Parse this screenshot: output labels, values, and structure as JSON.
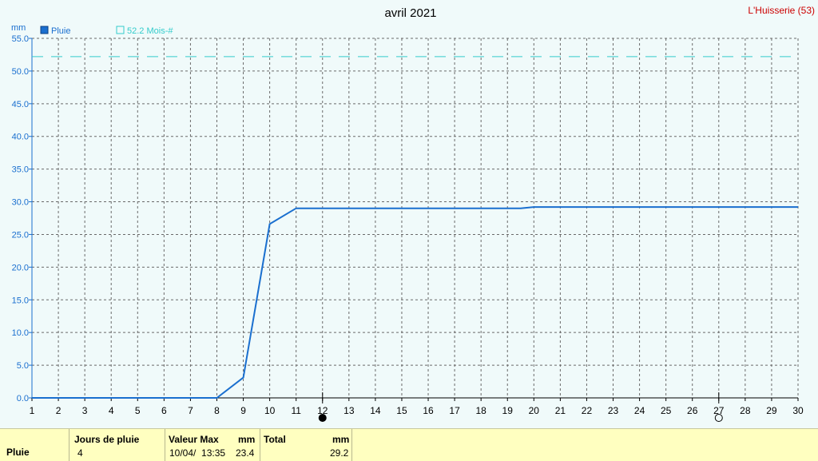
{
  "chart_data": {
    "type": "line",
    "title": "avril 2021",
    "station": "L'Huisserie (53)",
    "ylabel": "mm",
    "ylim": [
      0,
      55
    ],
    "xlim": [
      1,
      30
    ],
    "grid": true,
    "yticks": [
      "0.0",
      "5.0",
      "10.0",
      "15.0",
      "20.0",
      "25.0",
      "30.0",
      "35.0",
      "40.0",
      "45.0",
      "50.0",
      "55.0"
    ],
    "xticks": [
      "1",
      "2",
      "3",
      "4",
      "5",
      "6",
      "7",
      "8",
      "9",
      "10",
      "11",
      "12",
      "13",
      "14",
      "15",
      "16",
      "17",
      "18",
      "19",
      "20",
      "21",
      "22",
      "23",
      "24",
      "25",
      "26",
      "27",
      "28",
      "29",
      "30"
    ],
    "legend": {
      "series_name": "Pluie",
      "reference_label": "52.2 Mois-#"
    },
    "series": [
      {
        "name": "Pluie",
        "color": "#1a6fcf",
        "x": [
          1,
          8,
          9,
          10,
          11,
          19.5,
          20,
          30
        ],
        "y": [
          0,
          0,
          3.1,
          26.6,
          29.0,
          29.0,
          29.2,
          29.2
        ]
      }
    ],
    "reference_line": {
      "value": 52.2,
      "color": "#33cccc"
    },
    "moon_phases": [
      {
        "day": 12,
        "phase": "new-moon"
      },
      {
        "day": 27,
        "phase": "full-moon"
      }
    ]
  },
  "summary": {
    "row_label": "Pluie",
    "jours_label": "Jours de pluie",
    "jours_value": "4",
    "valeur_max_label": "Valeur Max",
    "valeur_max_unit": "mm",
    "valeur_max_date": "10/04/  13:35",
    "valeur_max_value": "23.4",
    "total_label": "Total",
    "total_unit": "mm",
    "total_value": "29.2"
  }
}
